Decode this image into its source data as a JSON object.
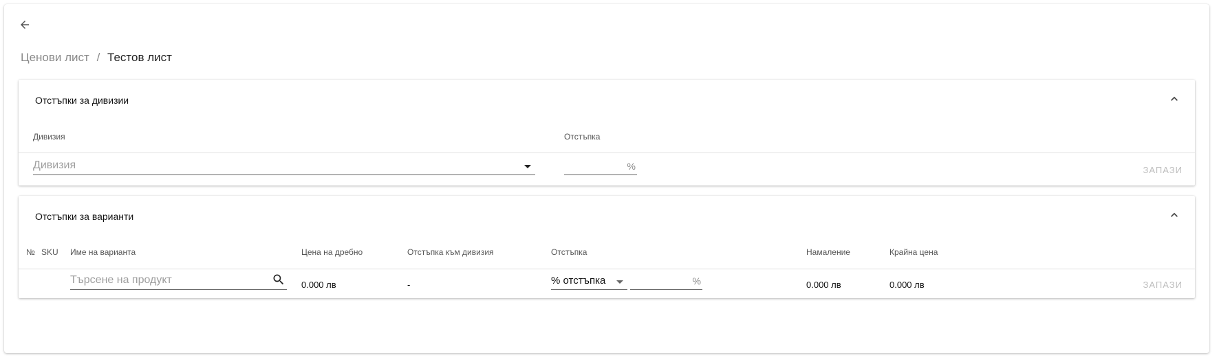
{
  "icons": {
    "back": "arrow-left-icon",
    "collapse": "chevron-up-icon",
    "search": "search-icon",
    "dropdown": "caret-down-icon"
  },
  "colors": {
    "text": "#212121",
    "muted": "#8a8a8a",
    "disabled": "#bdbdbd",
    "divider": "#e0e0e0"
  },
  "breadcrumb": {
    "parent": "Ценови лист",
    "separator": "/",
    "current": "Тестов лист"
  },
  "division_panel": {
    "title": "Отстъпки за дивизии",
    "col_division": "Дивизия",
    "col_discount": "Отстъпка",
    "division_placeholder": "Дивизия",
    "discount_value": "",
    "percent_suffix": "%",
    "save_label": "ЗАПАЗИ"
  },
  "variant_panel": {
    "title": "Отстъпки за варианти",
    "columns": {
      "no": "№",
      "sku": "SKU",
      "name": "Име на варианта",
      "retail_price": "Цена на дребно",
      "division_discount": "Отстъпка към дивизия",
      "discount": "Отстъпка",
      "reduction": "Намаление",
      "final_price": "Крайна цена"
    },
    "row": {
      "search_placeholder": "Търсене на продукт",
      "retail_price": "0.000 лв",
      "division_discount": "-",
      "discount_type": "% отстъпка",
      "discount_value": "",
      "percent_suffix": "%",
      "reduction": "0.000 лв",
      "final_price": "0.000 лв",
      "save_label": "ЗАПАЗИ"
    }
  }
}
